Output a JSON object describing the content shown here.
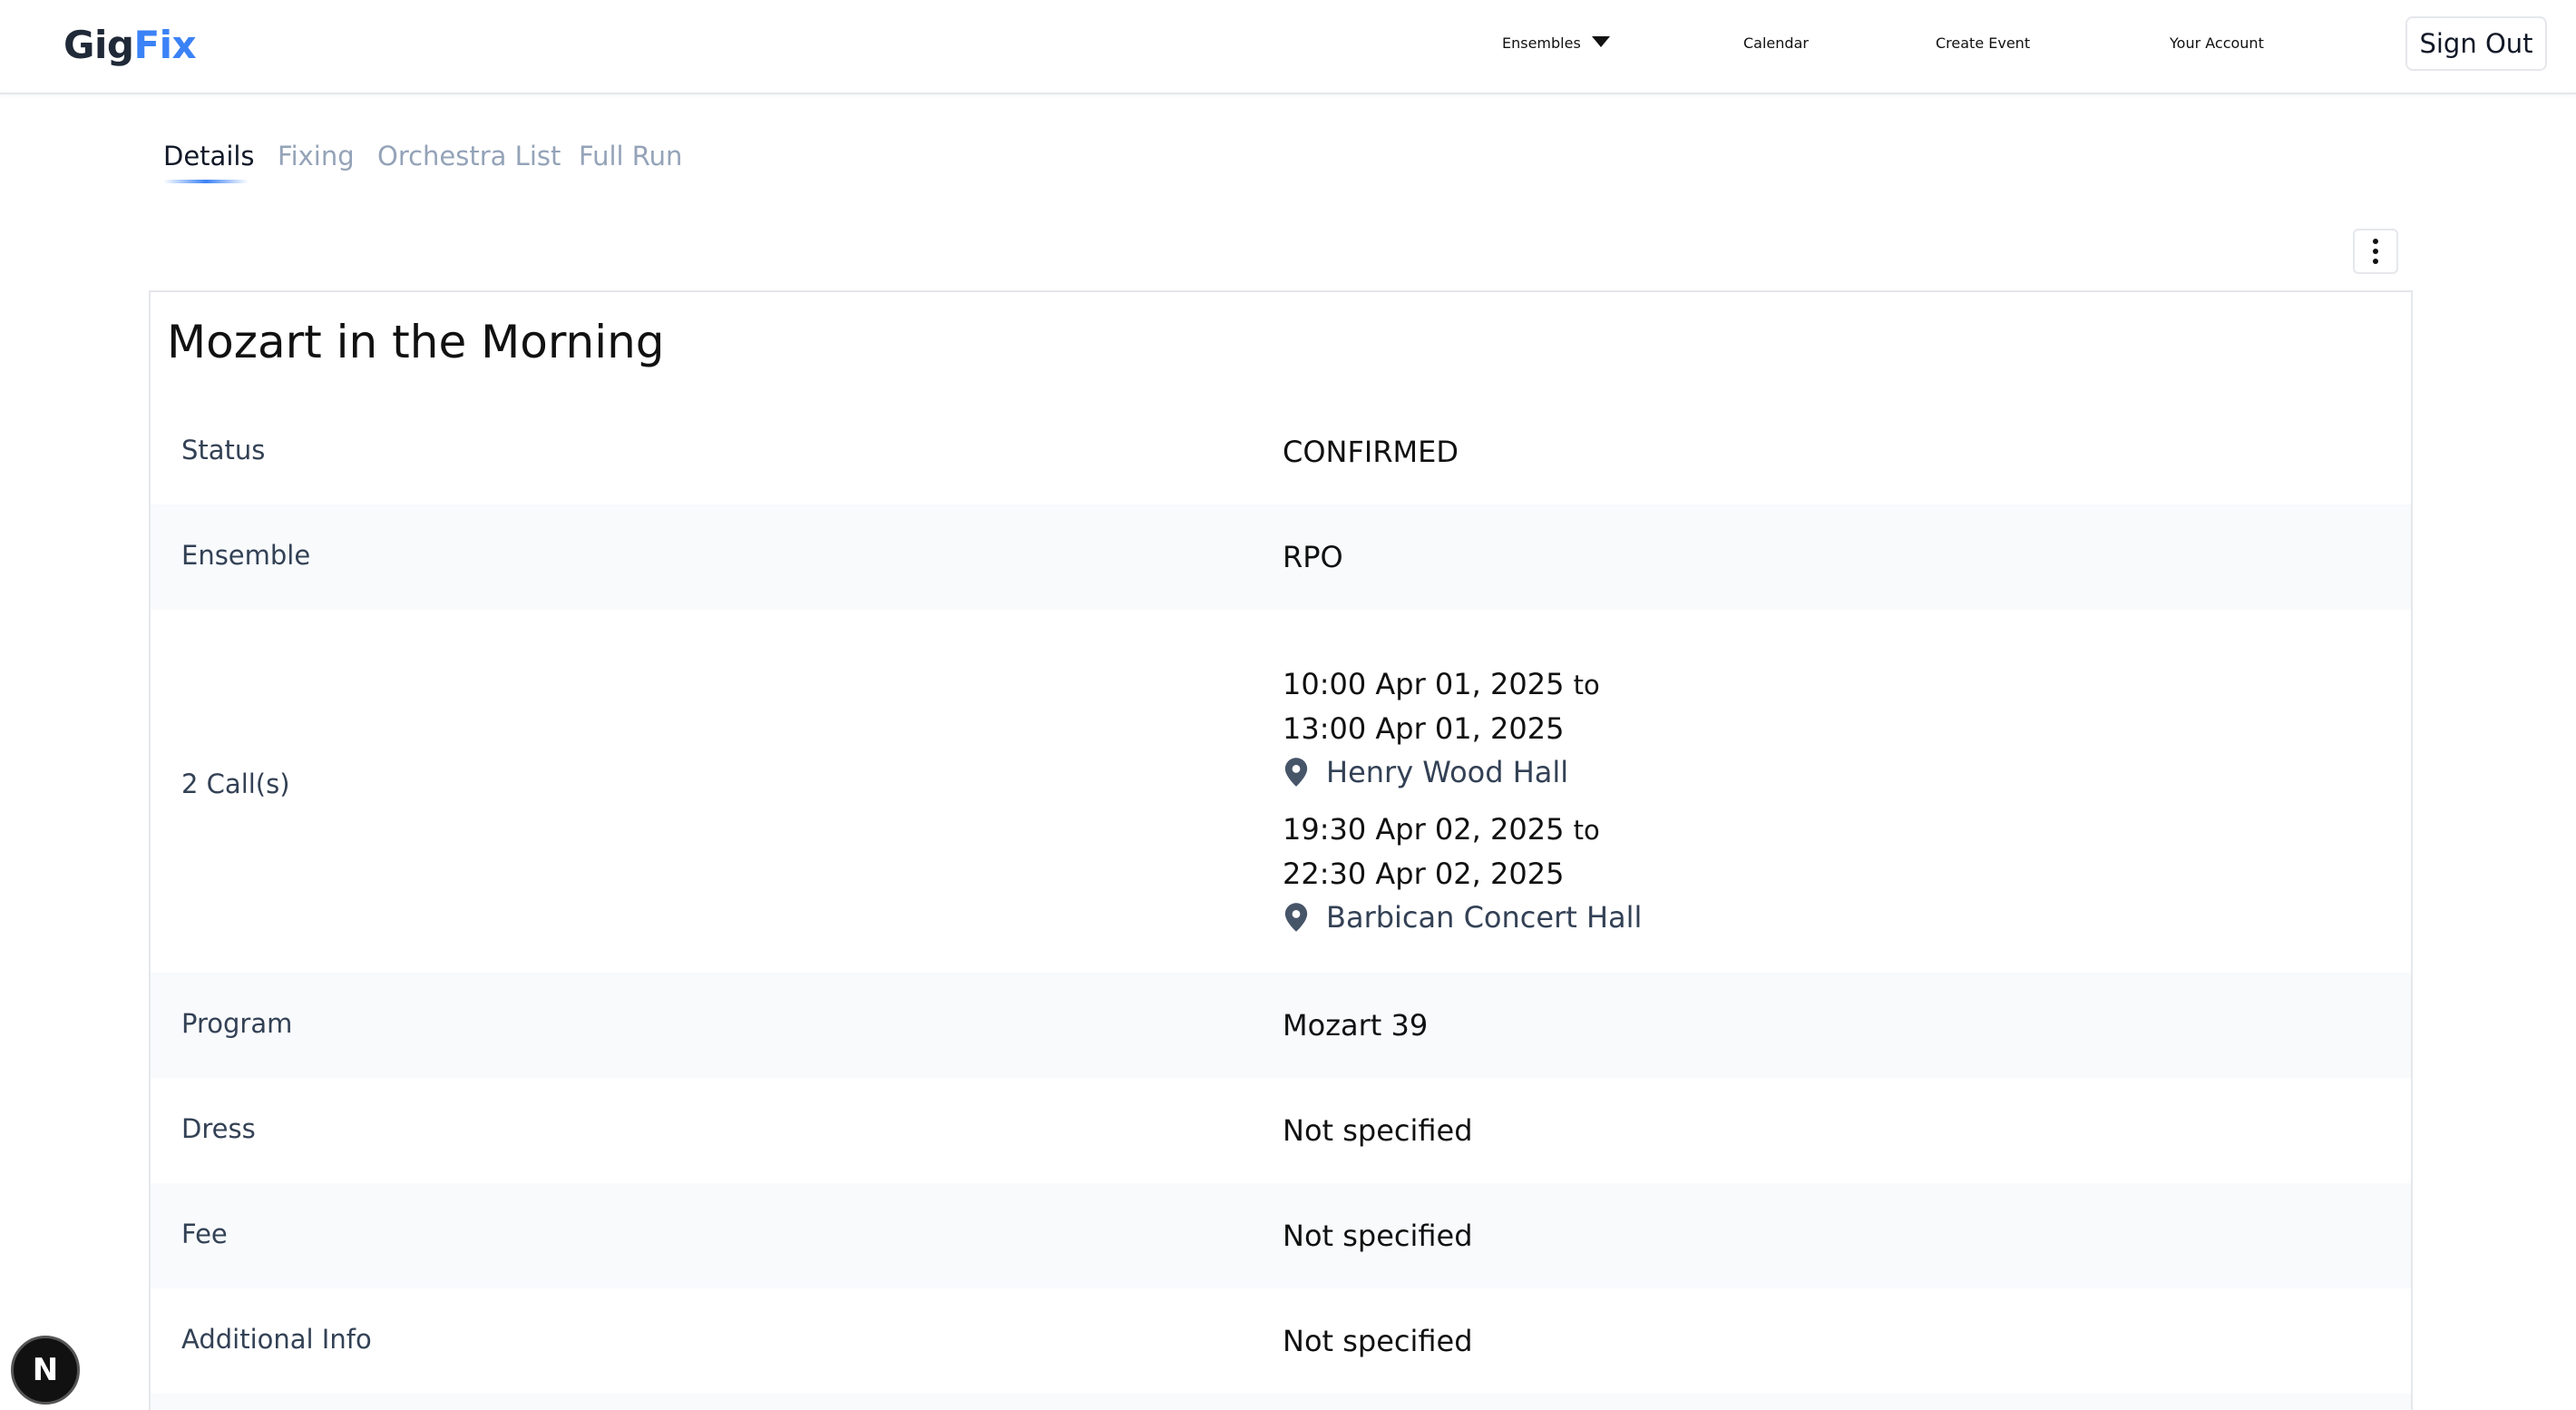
{
  "header": {
    "logo_part1": "Gig",
    "logo_part2": "Fix",
    "nav": {
      "ensembles": "Ensembles",
      "calendar": "Calendar",
      "create_event": "Create Event",
      "your_account": "Your Account",
      "sign_out": "Sign Out"
    }
  },
  "tabs": {
    "details": "Details",
    "fixing": "Fixing",
    "orchestra_list": "Orchestra List",
    "full_run": "Full Run"
  },
  "event": {
    "title": "Mozart in the Morning",
    "rows": {
      "status": {
        "label": "Status",
        "value": "CONFIRMED"
      },
      "ensemble": {
        "label": "Ensemble",
        "value": "RPO"
      },
      "calls": {
        "label": "2 Call(s)",
        "items": [
          {
            "start": "10:00 Apr 01, 2025",
            "to": "to",
            "end": "13:00 Apr 01, 2025",
            "venue": "Henry Wood Hall"
          },
          {
            "start": "19:30 Apr 02, 2025",
            "to": "to",
            "end": "22:30 Apr 02, 2025",
            "venue": "Barbican Concert Hall"
          }
        ]
      },
      "program": {
        "label": "Program",
        "value": "Mozart 39"
      },
      "dress": {
        "label": "Dress",
        "value": "Not specified"
      },
      "fee": {
        "label": "Fee",
        "value": "Not specified"
      },
      "additional_info": {
        "label": "Additional Info",
        "value": "Not specified"
      }
    }
  },
  "badge": {
    "letter": "N"
  },
  "colors": {
    "brand_accent": "#3b82f6",
    "row_alt": "#f8fafc",
    "muted_tab": "#94a3b8"
  },
  "icons": {
    "menu": "kebab-menu-icon",
    "venue": "location-pin-icon",
    "dropdown": "caret-down-icon"
  }
}
